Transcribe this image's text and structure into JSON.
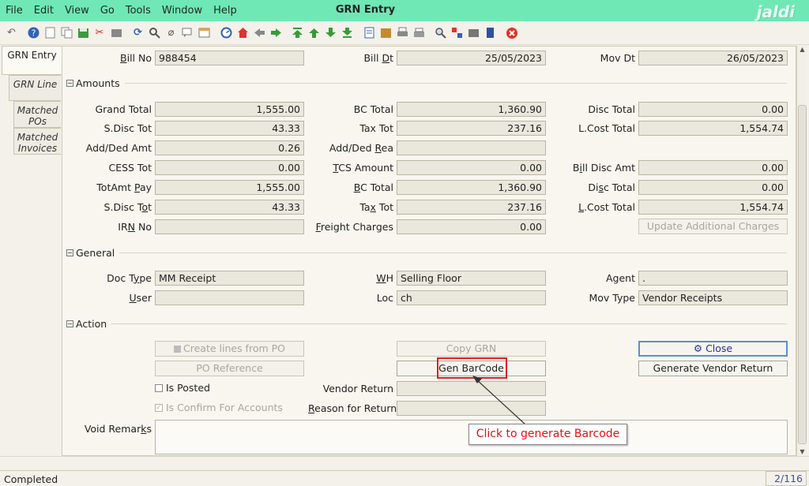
{
  "menu": {
    "file": "File",
    "edit": "Edit",
    "view": "View",
    "go": "Go",
    "tools": "Tools",
    "window": "Window",
    "help": "Help"
  },
  "window_title": "GRN Entry",
  "brand": "jaldi",
  "tabs": {
    "grn_entry": "GRN Entry",
    "grn_line": "GRN Line",
    "matched_pos": "Matched POs",
    "matched_invoices": "Matched Invoices"
  },
  "header": {
    "bill_no_label": "Bill No",
    "bill_no": "988454",
    "bill_dt_label": "Bill Dt",
    "bill_dt": "25/05/2023",
    "mov_dt_label": "Mov Dt",
    "mov_dt": "26/05/2023"
  },
  "amounts": {
    "title": "Amounts",
    "grand_total_label": "Grand Total",
    "grand_total": "1,555.00",
    "bc_total_label": "BC Total",
    "bc_total": "1,360.90",
    "disc_total_label": "Disc Total",
    "disc_total": "0.00",
    "sdisc_tot_label": "S.Disc Tot",
    "sdisc_tot": "43.33",
    "tax_tot_label": "Tax Tot",
    "tax_tot": "237.16",
    "lcost_total_label": "L.Cost Total",
    "lcost_total": "1,554.74",
    "add_ded_amt_label": "Add/Ded Amt",
    "add_ded_amt": "0.26",
    "add_ded_rea_label": "Add/Ded Rea",
    "add_ded_rea": "",
    "cess_tot_label": "CESS Tot",
    "cess_tot": "0.00",
    "tcs_amount_label": "TCS Amount",
    "tcs_amount": "0.00",
    "bill_disc_amt_label": "Bill Disc Amt",
    "bill_disc_amt": "0.00",
    "totamt_pay_label": "TotAmt Pay",
    "totamt_pay": "1,555.00",
    "bc_total2_label": "BC Total",
    "bc_total2": "1,360.90",
    "disc_total2_label": "Disc Total",
    "disc_total2": "0.00",
    "sdisc_tot2_label": "S.Disc Tot",
    "sdisc_tot2": "43.33",
    "tax_tot2_label": "Tax Tot",
    "tax_tot2": "237.16",
    "lcost_total2_label": "L.Cost Total",
    "lcost_total2": "1,554.74",
    "irn_no_label": "IRN No",
    "irn_no": "",
    "freight_label": "Freight Charges",
    "freight": "0.00",
    "update_charges_btn": "Update Additional Charges"
  },
  "general": {
    "title": "General",
    "doc_type_label": "Doc Type",
    "doc_type": "MM Receipt",
    "wh_label": "WH",
    "wh": "Selling Floor",
    "agent_label": "Agent",
    "agent": ".",
    "user_label": "User",
    "user": "",
    "loc_label": "Loc",
    "loc": "ch",
    "mov_type_label": "Mov Type",
    "mov_type": "Vendor Receipts"
  },
  "action": {
    "title": "Action",
    "create_lines_btn": "Create lines from PO",
    "copy_grn_btn": "Copy GRN",
    "close_btn": "Close",
    "po_reference_btn": "PO Reference",
    "gen_barcode_btn": "Gen BarCode",
    "generate_vendor_return_btn": "Generate Vendor Return",
    "is_posted_label": "Is Posted",
    "vendor_return_label": "Vendor Return",
    "vendor_return": "",
    "is_confirm_label": "Is Confirm For Accounts",
    "reason_label": "Reason for Return",
    "reason": "",
    "void_remarks_label": "Void Remarks",
    "void_remarks": ""
  },
  "callout": "Click to generate Barcode",
  "status": {
    "text": "Completed",
    "record": "2/116"
  }
}
